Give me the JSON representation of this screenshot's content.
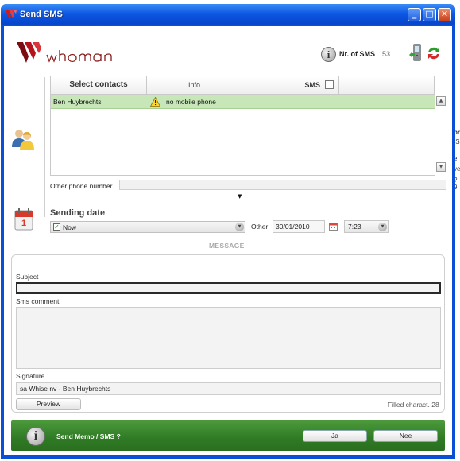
{
  "window": {
    "title": "Send SMS",
    "minimize_glyph": "_",
    "maximize_glyph": "□",
    "close_glyph": "✕"
  },
  "background_app": {
    "fragments": [
      "pr",
      "IS",
      "e",
      "ve",
      "?9"
    ]
  },
  "header": {
    "logo_icon": "whoman-logo",
    "nr_label": "Nr. of SMS",
    "nr_value": "53"
  },
  "contacts": {
    "columns": [
      "Select contacts",
      "Info",
      "SMS"
    ],
    "rows": [
      {
        "name": "Ben Huybrechts",
        "info": "no mobile phone",
        "warning_icon": "warning-icon"
      }
    ],
    "other_phone_label": "Other phone number",
    "other_phone_value": ""
  },
  "sending": {
    "label": "Sending date",
    "now_checked": true,
    "now_label": "Now",
    "other_label": "Other",
    "date": "30/01/2010",
    "time": "7:23"
  },
  "message": {
    "section_label": "MESSAGE",
    "subject_label": "Subject",
    "subject_value": "",
    "comment_label": "Sms comment",
    "comment_value": "",
    "signature_label": "Signature",
    "signature_value": "sa Whise nv - Ben Huybrechts",
    "preview_label": "Preview",
    "filled_text": "Filled charact. 28"
  },
  "footer": {
    "prompt": "Send Memo / SMS ?",
    "yes_label": "Ja",
    "no_label": "Nee"
  },
  "colors": {
    "title_bar": "#0b56e2",
    "selected_row": "#c7e7b8",
    "footer_green": "#3a8a2e",
    "logo_red": "#b5121b"
  }
}
